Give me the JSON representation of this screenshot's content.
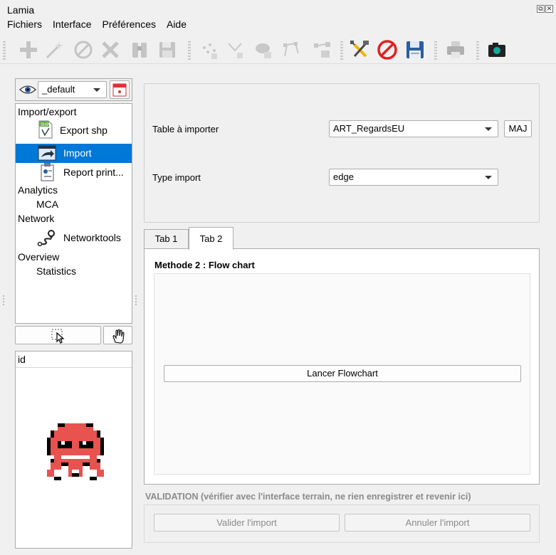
{
  "window": {
    "title": "Lamia",
    "buttons": [
      "⧉",
      "✕"
    ]
  },
  "menubar": {
    "items": [
      "Fichiers",
      "Interface",
      "Préférences",
      "Aide"
    ]
  },
  "toolbar": {
    "icons": [
      "add-icon",
      "magic-wand-icon",
      "cancel-icon",
      "delete-icon",
      "binoculars-icon",
      "save-disabled-icon",
      "points-icon",
      "node-icon",
      "stamp-icon",
      "line-nodes-icon",
      "table-nodes-icon",
      "tools-icon",
      "forbidden-icon",
      "save-icon",
      "print-icon",
      "camera-icon"
    ]
  },
  "sidebar": {
    "visibility_combo": "_default",
    "tree": [
      {
        "label": "Import/export",
        "type": "group"
      },
      {
        "label": "Export shp",
        "type": "item",
        "icon": "shp-file-icon"
      },
      {
        "label": "Import",
        "type": "item",
        "icon": "import-icon",
        "selected": true
      },
      {
        "label": "Report print...",
        "type": "item",
        "icon": "report-icon"
      },
      {
        "label": "Analytics",
        "type": "group"
      },
      {
        "label": "MCA",
        "type": "subitem"
      },
      {
        "label": "Network",
        "type": "group"
      },
      {
        "label": "Networktools",
        "type": "item",
        "icon": "network-route-icon"
      },
      {
        "label": "Overview",
        "type": "group"
      },
      {
        "label": "Statistics",
        "type": "subitem"
      }
    ],
    "id_header": "id",
    "colors": {
      "selection": "#0078d7",
      "mascot": "#e8524f"
    }
  },
  "form": {
    "table_label": "Table à importer",
    "table_value": "ART_RegardsEU",
    "maj_button": "MAJ",
    "type_label": "Type import",
    "type_value": "edge"
  },
  "tabs": {
    "items": [
      "Tab 1",
      "Tab 2"
    ],
    "active": "Tab 2"
  },
  "tab2": {
    "heading": "Methode 2 : Flow chart",
    "flowchart_button": "Lancer Flowchart"
  },
  "validation": {
    "label": "VALIDATION (vérifier avec l'interface terrain, ne rien enregistrer et revenir ici)",
    "validate_button": "Valider l'import",
    "cancel_button": "Annuler l'import"
  }
}
